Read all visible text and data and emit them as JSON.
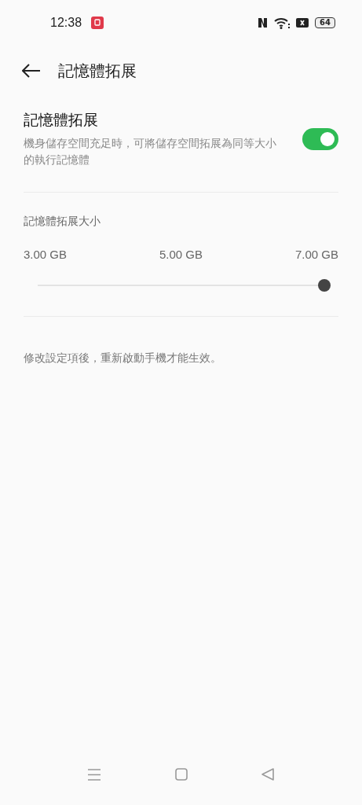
{
  "status_bar": {
    "time": "12:38",
    "battery": "64"
  },
  "header": {
    "title": "記憶體拓展"
  },
  "toggle_setting": {
    "title": "記憶體拓展",
    "description": "機身儲存空間充足時，可將儲存空間拓展為同等大小的執行記憶體",
    "on": true
  },
  "size_setting": {
    "label": "記憶體拓展大小",
    "ticks": [
      "3.00 GB",
      "5.00 GB",
      "7.00 GB"
    ],
    "level": 1
  },
  "note": "修改設定項後，重新啟動手機才能生效。"
}
